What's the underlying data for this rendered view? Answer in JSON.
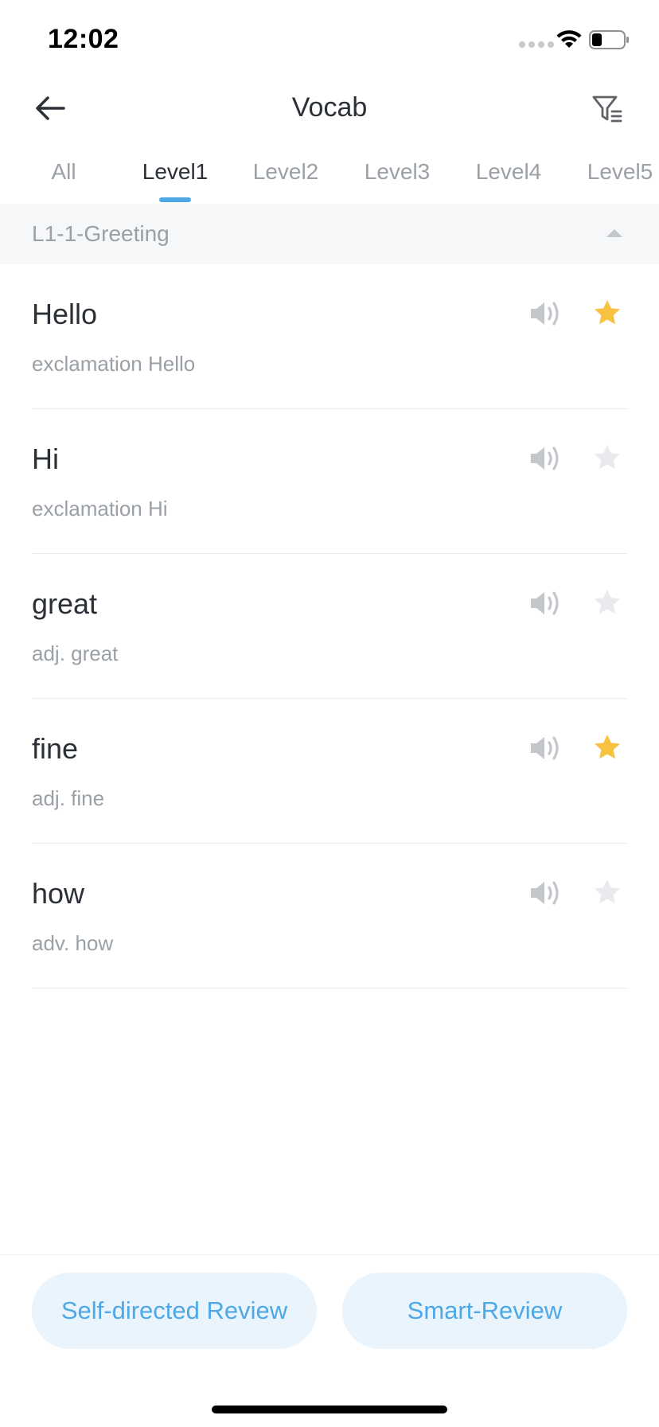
{
  "status_bar": {
    "time": "12:02",
    "icons": [
      "signal-dots-icon",
      "wifi-icon",
      "battery-icon"
    ]
  },
  "nav": {
    "title": "Vocab",
    "back_icon": "arrow-left-icon",
    "filter_icon": "filter-icon"
  },
  "tabs": [
    {
      "label": "All",
      "active": false
    },
    {
      "label": "Level1",
      "active": true
    },
    {
      "label": "Level2",
      "active": false
    },
    {
      "label": "Level3",
      "active": false
    },
    {
      "label": "Level4",
      "active": false
    },
    {
      "label": "Level5",
      "active": false
    }
  ],
  "section": {
    "title": "L1-1-Greeting",
    "expanded": true
  },
  "words": [
    {
      "term": "Hello",
      "meaning": "exclamation Hello",
      "starred": true
    },
    {
      "term": "Hi",
      "meaning": "exclamation Hi",
      "starred": false
    },
    {
      "term": "great",
      "meaning": "adj. great",
      "starred": false
    },
    {
      "term": "fine",
      "meaning": "adj. fine",
      "starred": true
    },
    {
      "term": "how",
      "meaning": "adv. how",
      "starred": false
    }
  ],
  "actions": {
    "self_review": "Self-directed Review",
    "smart_review": "Smart-Review"
  },
  "colors": {
    "accent": "#4fa8e6",
    "star_on": "#f7c241",
    "star_off": "#e8eaed",
    "speaker": "#c3c6ca",
    "button_bg": "#e9f4fc"
  }
}
